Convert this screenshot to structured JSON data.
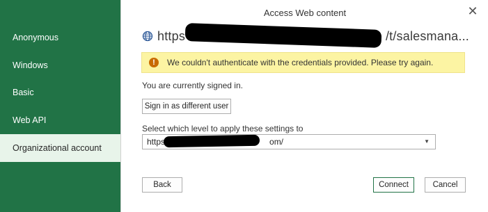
{
  "sidebar": {
    "items": [
      {
        "label": "Anonymous"
      },
      {
        "label": "Windows"
      },
      {
        "label": "Basic"
      },
      {
        "label": "Web API"
      },
      {
        "label": "Organizational account"
      }
    ],
    "selected_index": 4
  },
  "dialog": {
    "title": "Access Web content",
    "close_glyph": "✕",
    "url_prefix": "https",
    "url_suffix": "/t/salesmana...",
    "warning_icon": "!",
    "warning_text": "We couldn't authenticate with the credentials provided. Please try again.",
    "signed_in_text": "You are currently signed in.",
    "sign_in_button": "Sign in as different user",
    "level_label": "Select which level to apply these settings to",
    "level_select": {
      "prefix": "https",
      "suffix": "om/"
    },
    "back_button": "Back",
    "connect_button": "Connect",
    "cancel_button": "Cancel"
  },
  "colors": {
    "sidebar_bg": "#217346",
    "selected_bg": "#e8f4ea",
    "warning_bg": "#fcf4a3",
    "warning_icon": "#c86b00"
  },
  "icons": {
    "url": "globe-icon",
    "warning": "warning-icon",
    "close": "close-icon",
    "dropdown": "chevron-down-icon"
  }
}
